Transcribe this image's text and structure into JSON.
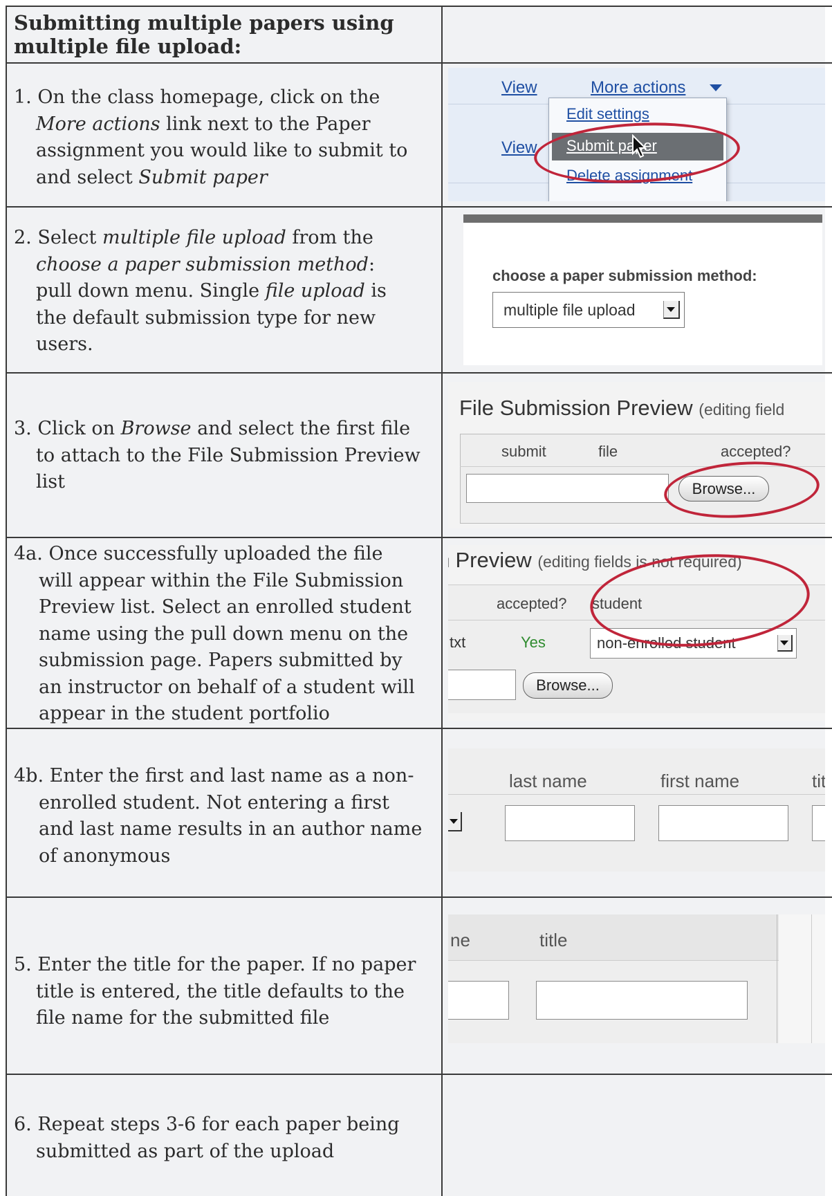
{
  "header": {
    "title_line1": "Submitting multiple papers using",
    "title_line2": "multiple file upload:"
  },
  "steps": [
    {
      "lines": [
        "1. On the class homepage, click on the",
        "More actions link next to the Paper",
        "assignment you would like to submit to",
        "and select Submit paper"
      ]
    },
    {
      "lines": [
        "2. Select multiple file upload from the",
        "choose a paper submission method:",
        "pull down menu. Single file upload is",
        "the default submission type for new",
        "users."
      ]
    },
    {
      "lines": [
        "3. Click on Browse and select the first file",
        "to attach to the File Submission Preview",
        "list"
      ]
    },
    {
      "lines": [
        "4a. Once successfully uploaded the file",
        "will appear within the File Submission",
        "Preview list. Select an enrolled student",
        "name using the pull down menu on the",
        "submission page. Papers submitted by",
        "an instructor on behalf of a student will",
        "appear in the student portfolio"
      ]
    },
    {
      "lines": [
        "4b. Enter the first and last name as a non-",
        "enrolled student. Not entering a first",
        "and last name results in an author name",
        "of anonymous"
      ]
    },
    {
      "lines": [
        "5. Enter the title for the paper. If no paper",
        "title is entered, the title defaults to the",
        "file name for the submitted file"
      ]
    },
    {
      "lines": [
        "6. Repeat steps 3-6 for each paper being",
        "submitted as part of the upload"
      ]
    }
  ],
  "shot1": {
    "view1": "View",
    "more_actions": "More actions",
    "edit_settings": "Edit settings",
    "view2": "View",
    "submit_paper": "Submit paper",
    "delete_assignment": "Delete assignment"
  },
  "shot2": {
    "label": "choose a paper submission method:",
    "select_value": "multiple file upload"
  },
  "shot3": {
    "title": "File Submission Preview",
    "subtitle": "(editing field",
    "col_submit": "submit",
    "col_file": "file",
    "col_accepted": "accepted?",
    "browse": "Browse..."
  },
  "shot4a": {
    "title": "Preview",
    "subtitle": "(editing fields is not required)",
    "col_accepted": "accepted?",
    "col_student": "student",
    "file_ext": "txt",
    "accepted_value": "Yes",
    "student_value": "non-enrolled student",
    "browse": "Browse..."
  },
  "shot4b": {
    "col_last": "last name",
    "col_first": "first name",
    "col_title_partial": "tit"
  },
  "shot5": {
    "col_partial": "ne",
    "col_title": "title"
  },
  "colors": {
    "cell_bg": "#f1f2f4",
    "border": "#3a3a3a",
    "highlight_ring": "#c0253a",
    "link": "#1f4fa3",
    "yes_green": "#2e8b2e"
  }
}
